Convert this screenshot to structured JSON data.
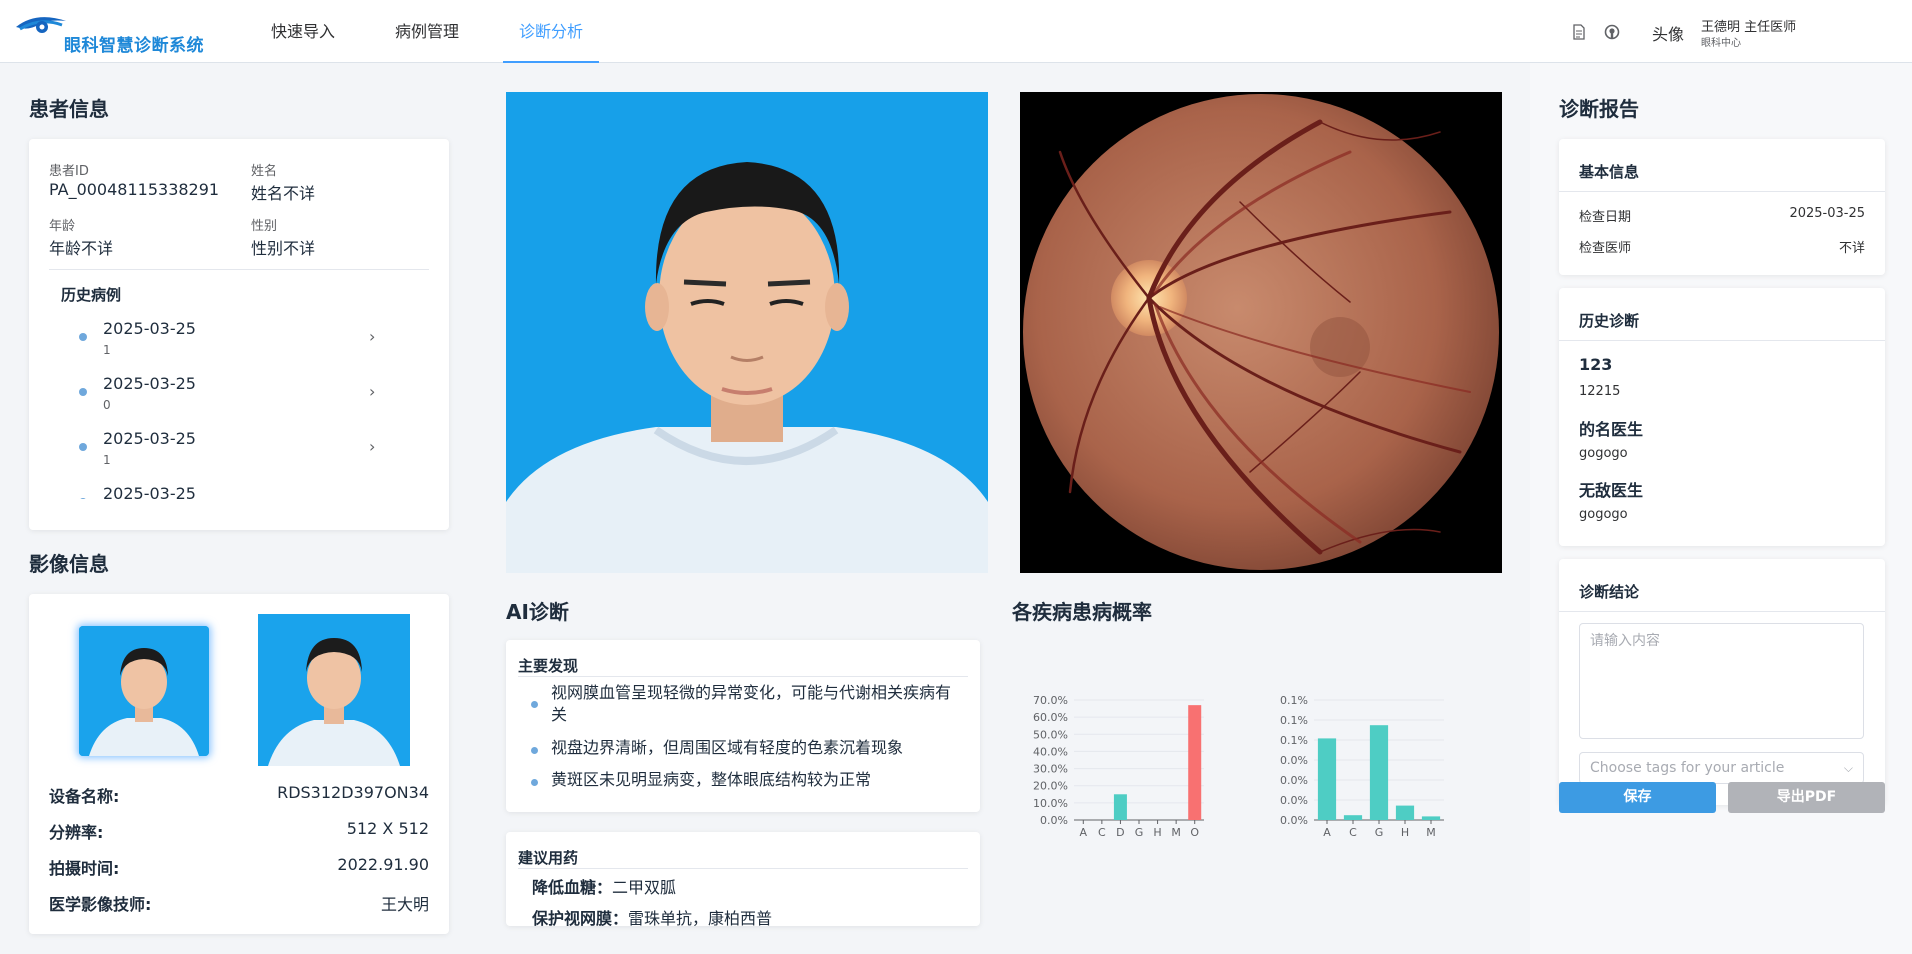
{
  "app": {
    "title": "眼科智慧诊断系统"
  },
  "nav": {
    "items": [
      {
        "label": "快速导入",
        "active": false
      },
      {
        "label": "病例管理",
        "active": false
      },
      {
        "label": "诊断分析",
        "active": true
      }
    ]
  },
  "header": {
    "icons": [
      "document-icon",
      "github-icon"
    ],
    "avatar_label": "头像",
    "user_name": "王德明 主任医师",
    "department": "眼科中心"
  },
  "patient": {
    "section_title": "患者信息",
    "id_label": "患者ID",
    "id_value": "PA_00048115338291",
    "name_label": "姓名",
    "name_value": "姓名不详",
    "age_label": "年龄",
    "age_value": "年龄不详",
    "gender_label": "性别",
    "gender_value": "性别不详",
    "history_title": "历史病例",
    "history": [
      {
        "date": "2025-03-25",
        "sub": "1"
      },
      {
        "date": "2025-03-25",
        "sub": "0"
      },
      {
        "date": "2025-03-25",
        "sub": "1"
      },
      {
        "date": "2025-03-25",
        "sub": ""
      }
    ]
  },
  "imaging": {
    "section_title": "影像信息",
    "device_label": "设备名称:",
    "device_value": "RDS312D397ON34",
    "resolution_label": "分辨率:",
    "resolution_value": "512 X 512",
    "time_label": "拍摄时间:",
    "time_value": "2022.91.90",
    "tech_label": "医学影像技师:",
    "tech_value": "王大明"
  },
  "ai": {
    "section_title": "AI诊断",
    "findings_title": "主要发现",
    "findings": [
      "视网膜血管呈现轻微的异常变化，可能与代谢相关疾病有关",
      "视盘边界清晰，但周围区域有轻度的色素沉着现象",
      "黄斑区未见明显病变，整体眼底结构较为正常"
    ],
    "meds_title": "建议用药",
    "meds": [
      {
        "label": "降低血糖：",
        "value": "二甲双胍"
      },
      {
        "label": "保护视网膜：",
        "value": "雷珠单抗，康柏西普"
      }
    ]
  },
  "probability": {
    "section_title": "各疾病患病概率"
  },
  "chart_data": [
    {
      "type": "bar",
      "categories": [
        "A",
        "C",
        "D",
        "G",
        "H",
        "M",
        "O"
      ],
      "values": [
        0.0,
        0.0,
        15.0,
        0.0,
        0.0,
        0.0,
        67.0
      ],
      "colors": [
        "#4ecdc4",
        "#4ecdc4",
        "#4ecdc4",
        "#4ecdc4",
        "#4ecdc4",
        "#4ecdc4",
        "#f87171"
      ],
      "yticks": [
        "0.0%",
        "10.0%",
        "20.0%",
        "30.0%",
        "40.0%",
        "50.0%",
        "60.0%",
        "70.0%"
      ],
      "ylim": [
        0,
        70
      ]
    },
    {
      "type": "bar",
      "categories": [
        "A",
        "C",
        "G",
        "H",
        "M"
      ],
      "values": [
        0.068,
        0.004,
        0.079,
        0.012,
        0.003
      ],
      "colors": [
        "#4ecdc4",
        "#4ecdc4",
        "#4ecdc4",
        "#4ecdc4",
        "#4ecdc4"
      ],
      "yticks": [
        "0.0%",
        "0.0%",
        "0.0%",
        "0.0%",
        "0.1%",
        "0.1%",
        "0.1%"
      ],
      "ylim": [
        0,
        0.1
      ]
    }
  ],
  "report": {
    "section_title": "诊断报告",
    "basic_title": "基本信息",
    "exam_date_label": "检查日期",
    "exam_date_value": "2025-03-25",
    "doctor_label": "检查医师",
    "doctor_value": "不详",
    "history_title": "历史诊断",
    "history": [
      {
        "title": "123",
        "sub": "12215"
      },
      {
        "title": "的名医生",
        "sub": "gogogo"
      },
      {
        "title": "无敌医生",
        "sub": "gogogo"
      }
    ],
    "conclusion_title": "诊断结论",
    "conclusion_placeholder": "请输入内容",
    "tags_placeholder": "Choose tags for your article",
    "save_label": "保存",
    "export_label": "导出PDF",
    "colors": {
      "save": "#3d9be3",
      "export": "#b1b3b8"
    }
  }
}
